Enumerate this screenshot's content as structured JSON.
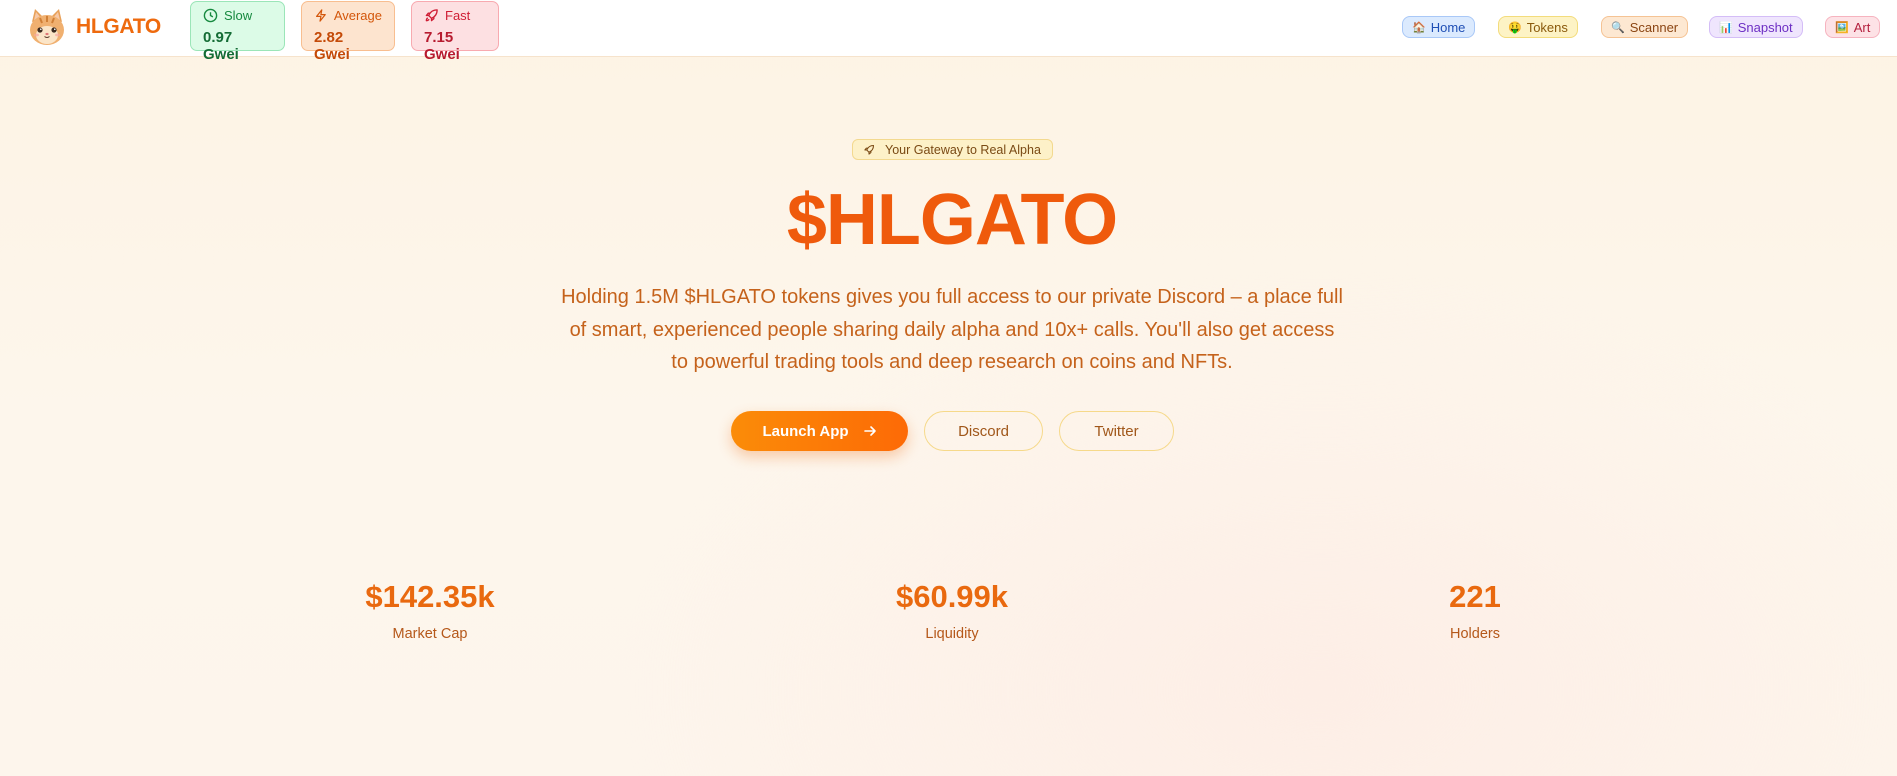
{
  "header": {
    "brand": "HLGATO",
    "gas": [
      {
        "label": "Slow",
        "value": "0.97 Gwei",
        "icon": "clock-icon"
      },
      {
        "label": "Average",
        "value": "2.82 Gwei",
        "icon": "lightning-icon"
      },
      {
        "label": "Fast",
        "value": "7.15 Gwei",
        "icon": "rocket-icon"
      }
    ],
    "nav": [
      {
        "emoji": "🏠",
        "label": "Home"
      },
      {
        "emoji": "🤑",
        "label": "Tokens"
      },
      {
        "emoji": "🔍",
        "label": "Scanner"
      },
      {
        "emoji": "📊",
        "label": "Snapshot"
      },
      {
        "emoji": "🖼️",
        "label": "Art"
      }
    ]
  },
  "hero": {
    "tagline": "Your Gateway to Real Alpha",
    "title": "$HLGATO",
    "description": "Holding 1.5M $HLGATO tokens gives you full access to our private Discord – a place full of smart, experienced people sharing daily alpha and 10x+ calls. You'll also get access to powerful trading tools and deep research on coins and NFTs.",
    "buttons": {
      "launch": "Launch App",
      "discord": "Discord",
      "twitter": "Twitter"
    }
  },
  "stats": [
    {
      "value": "$142.35k",
      "label": "Market Cap"
    },
    {
      "value": "$60.99k",
      "label": "Liquidity"
    },
    {
      "value": "221",
      "label": "Holders"
    }
  ],
  "colors": {
    "brand": "#ee6a0e",
    "accent_gradient_start": "#fb8c08",
    "accent_gradient_end": "#fd6a06"
  }
}
